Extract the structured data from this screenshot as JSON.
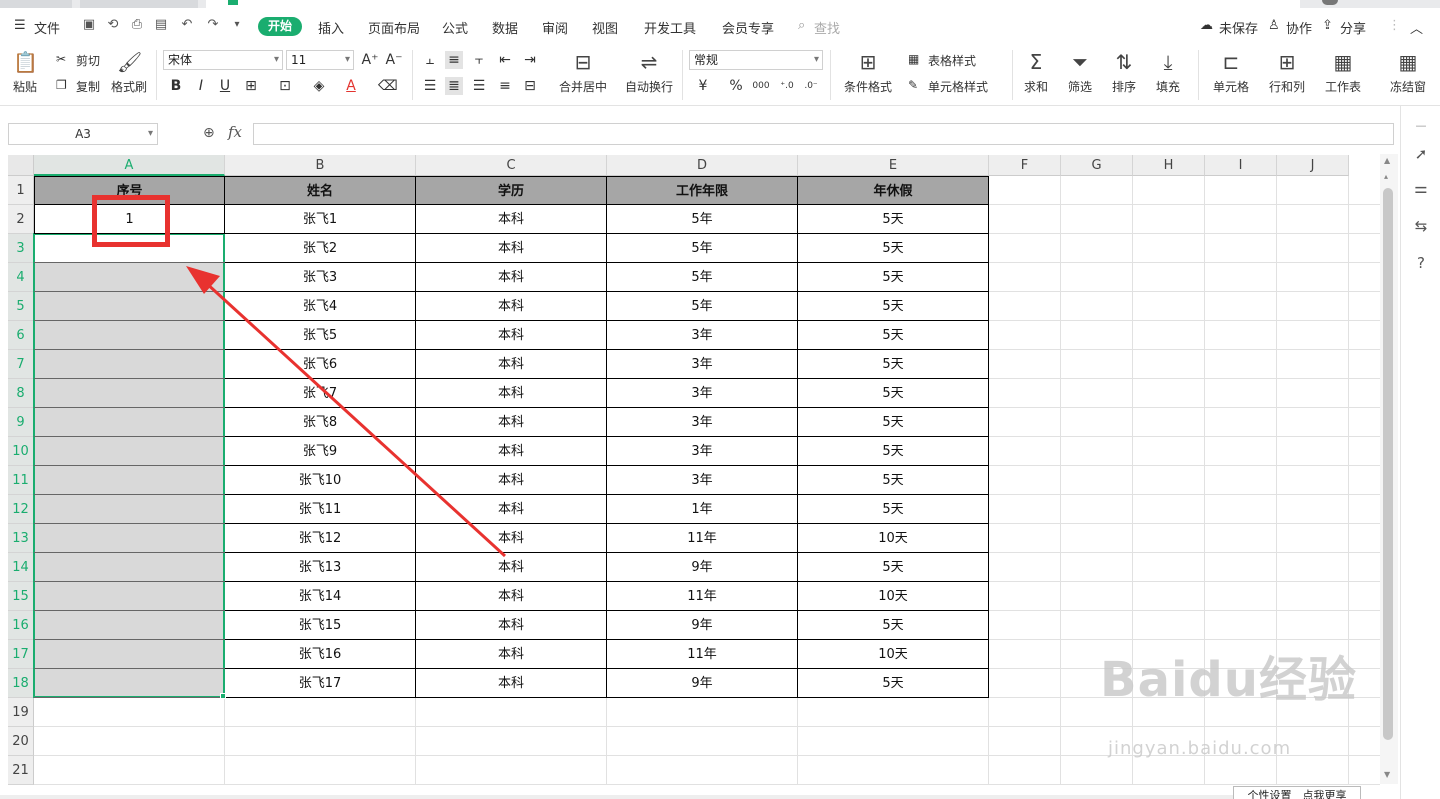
{
  "menubar": {
    "file": "文件",
    "tabs": [
      "开始",
      "插入",
      "页面布局",
      "公式",
      "数据",
      "审阅",
      "视图",
      "开发工具",
      "会员专享"
    ],
    "search": "查找",
    "unsaved": "未保存",
    "collab": "协作",
    "share": "分享"
  },
  "toolbar": {
    "paste": "粘贴",
    "cut": "剪切",
    "copy": "复制",
    "format_painter": "格式刷",
    "font_name": "宋体",
    "font_size": "11",
    "merge_center": "合并居中",
    "wrap": "自动换行",
    "number_format": "常规",
    "currency": "¥",
    "percent": "%",
    "thousands": "000",
    "cond_format": "条件格式",
    "table_style": "表格样式",
    "cell_style": "单元格样式",
    "sum": "求和",
    "filter": "筛选",
    "sort": "排序",
    "fill": "填充",
    "cell": "单元格",
    "row_col": "行和列",
    "worksheet": "工作表",
    "freeze": "冻结窗"
  },
  "formula": {
    "cell_ref": "A3",
    "fx": "fx",
    "content": ""
  },
  "sheet": {
    "columns": [
      "A",
      "B",
      "C",
      "D",
      "E",
      "F",
      "G",
      "H",
      "I",
      "J"
    ],
    "rows": [
      "1",
      "2",
      "3",
      "4",
      "5",
      "6",
      "7",
      "8",
      "9",
      "10",
      "11",
      "12",
      "13",
      "14",
      "15",
      "16",
      "17",
      "18",
      "19",
      "20",
      "21"
    ],
    "header": [
      "序号",
      "姓名",
      "学历",
      "工作年限",
      "年休假"
    ],
    "data": [
      [
        "1",
        "张飞1",
        "本科",
        "5年",
        "5天"
      ],
      [
        "",
        "张飞2",
        "本科",
        "5年",
        "5天"
      ],
      [
        "",
        "张飞3",
        "本科",
        "5年",
        "5天"
      ],
      [
        "",
        "张飞4",
        "本科",
        "5年",
        "5天"
      ],
      [
        "",
        "张飞5",
        "本科",
        "3年",
        "5天"
      ],
      [
        "",
        "张飞6",
        "本科",
        "3年",
        "5天"
      ],
      [
        "",
        "张飞7",
        "本科",
        "3年",
        "5天"
      ],
      [
        "",
        "张飞8",
        "本科",
        "3年",
        "5天"
      ],
      [
        "",
        "张飞9",
        "本科",
        "3年",
        "5天"
      ],
      [
        "",
        "张飞10",
        "本科",
        "3年",
        "5天"
      ],
      [
        "",
        "张飞11",
        "本科",
        "1年",
        "5天"
      ],
      [
        "",
        "张飞12",
        "本科",
        "11年",
        "10天"
      ],
      [
        "",
        "张飞13",
        "本科",
        "9年",
        "5天"
      ],
      [
        "",
        "张飞14",
        "本科",
        "11年",
        "10天"
      ],
      [
        "",
        "张飞15",
        "本科",
        "9年",
        "5天"
      ],
      [
        "",
        "张飞16",
        "本科",
        "11年",
        "10天"
      ],
      [
        "",
        "张飞17",
        "本科",
        "9年",
        "5天"
      ]
    ]
  },
  "watermark": {
    "logo": "Baidu经验",
    "url": "jingyan.baidu.com"
  },
  "bottom_button": "个性设置　点我更享",
  "colors": {
    "accent": "#1aad6f",
    "header_bg": "#a6a6a6",
    "annotation": "#e8322f"
  }
}
